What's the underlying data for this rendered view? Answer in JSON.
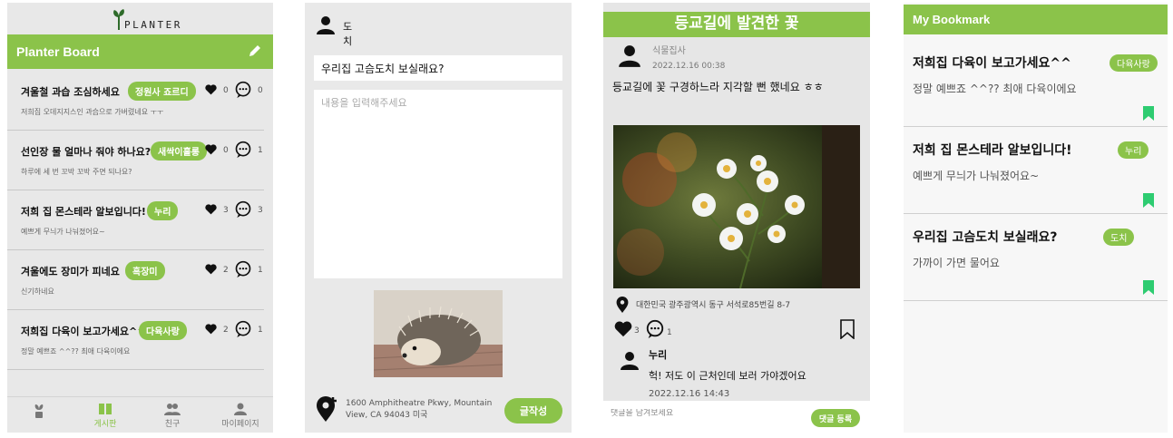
{
  "colors": {
    "accent": "#8bc34a",
    "header_text": "#ffffff"
  },
  "board": {
    "logo_text": "PLANTER",
    "title": "Planter Board",
    "posts": [
      {
        "title": "겨울철 과습 조심하세요",
        "snippet": "저희집 오데지지스인 과습으로 가버렸네요 ㅜㅜ",
        "tag": "정원사 죠르디",
        "likes": "0",
        "comments": "0"
      },
      {
        "title": "선인장 물 얼마나 줘야 하나요?",
        "snippet": "하루에 세 번 꼬박 꼬박 주면 되나요?",
        "tag": "새싹이홀롱",
        "likes": "0",
        "comments": "1"
      },
      {
        "title": "저희 집 몬스테라 알보입니다!",
        "snippet": "예쁘게 무늬가 나눠졌어요~",
        "tag": "누리",
        "likes": "3",
        "comments": "3"
      },
      {
        "title": "겨울에도 장미가 피네요",
        "snippet": "신기하네요",
        "tag": "흑장미",
        "likes": "2",
        "comments": "1"
      },
      {
        "title": "저희집 다육이 보고가세요^^",
        "snippet": "정말 예쁘죠 ^^?? 최애 다육이에요",
        "tag": "다육사랑",
        "likes": "2",
        "comments": "1"
      }
    ],
    "nav": [
      {
        "label": "",
        "icon": "plant-icon"
      },
      {
        "label": "게시판",
        "icon": "board-icon"
      },
      {
        "label": "친구",
        "icon": "friends-icon"
      },
      {
        "label": "마이페이지",
        "icon": "person-icon"
      }
    ]
  },
  "write": {
    "author": "도치",
    "title_value": "우리집 고슴도치 보실래요?",
    "body_placeholder": "내용을 입력해주세요",
    "address": "1600 Amphitheatre Pkwy, Mountain View, CA 94043 미국",
    "submit_label": "글작성"
  },
  "detail": {
    "title": "등교길에 발견한 꽃",
    "author": "식물집사",
    "date": "2022.12.16 00:38",
    "text": "등교길에 꽃 구경하느라 지각할 뻔 했네요 ㅎㅎ",
    "location": "대한민국 광주광역시 동구 서석로85번길 8-7",
    "likes": "3",
    "comments": "1",
    "comment": {
      "name": "누리",
      "text": "헉! 저도 이 근처인데 보러 가야겠어요",
      "date": "2022.12.16 14:43"
    },
    "comment_placeholder": "댓글을 남겨보세요",
    "comment_submit": "댓글 등록"
  },
  "bookmarks": {
    "title": "My Bookmark",
    "items": [
      {
        "title": "저희집 다육이 보고가세요^^",
        "tag": "다육사랑",
        "snippet": "정말 예쁘죠 ^^?? 최애 다육이에요"
      },
      {
        "title": "저희 집 몬스테라 알보입니다!",
        "tag": "누리",
        "snippet": "예쁘게 무늬가 나눠졌어요~"
      },
      {
        "title": "우리집 고슴도치 보실래요?",
        "tag": "도치",
        "snippet": "가까이 가면 물어요"
      }
    ]
  }
}
